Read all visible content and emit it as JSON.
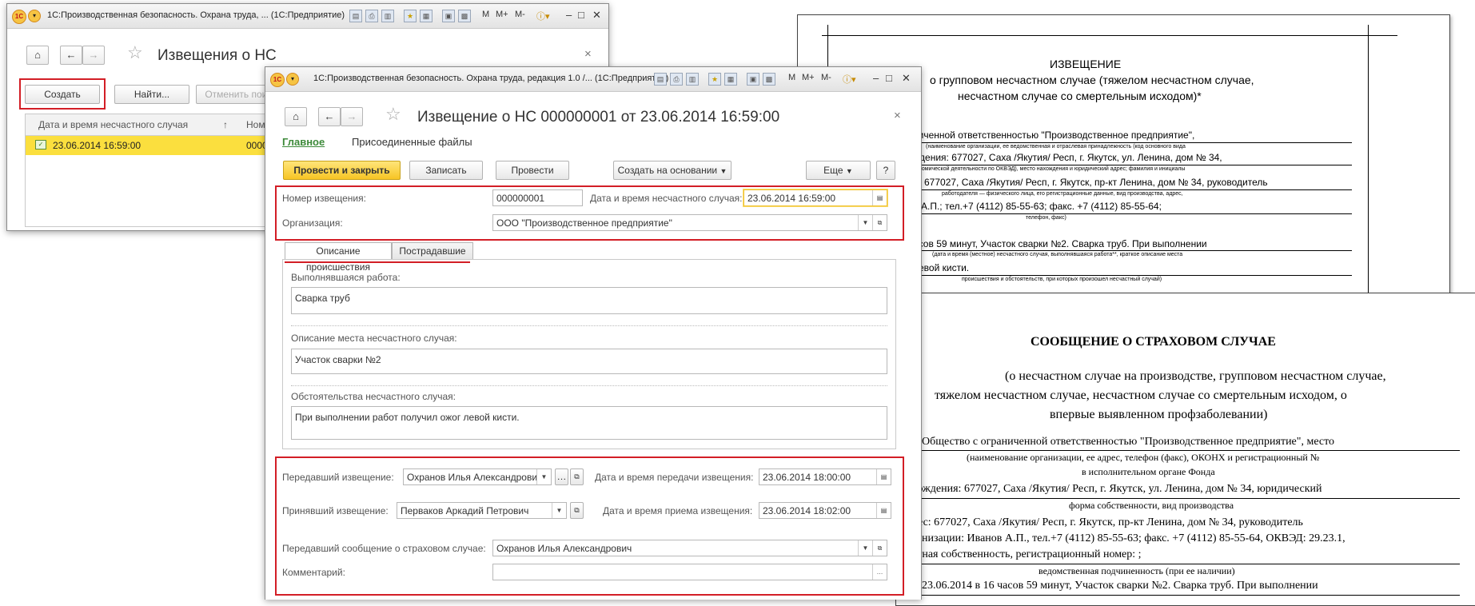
{
  "window_back": {
    "title": "1С:Производственная безопасность. Охрана труда, ...  (1С:Предприятие)",
    "heading": "Извещения о НС",
    "buttons": {
      "create": "Создать",
      "find": "Найти...",
      "cancel_find": "Отменить поиск"
    },
    "list": {
      "col1": "Дата и время несчастного случая",
      "col1_sort": "↑",
      "col2": "Номер",
      "row_date": "23.06.2014 16:59:00",
      "row_num": "000000001"
    }
  },
  "window_front": {
    "title": "1С:Производственная безопасность. Охрана труда, редакция 1.0 /...  (1С:Предприятие)",
    "heading": "Извещение о НС 000000001 от 23.06.2014 16:59:00",
    "nav": {
      "main": "Главное",
      "files": "Присоединенные файлы"
    },
    "toolbar": {
      "post_close": "Провести и закрыть",
      "save": "Записать",
      "post": "Провести",
      "create_based": "Создать на основании",
      "more": "Еще",
      "help": "?"
    },
    "fields": {
      "number_label": "Номер извещения:",
      "number_value": "000000001",
      "datetime_label": "Дата и время несчастного случая:",
      "datetime_value": "23.06.2014 16:59:00",
      "org_label": "Организация:",
      "org_value": "ООО \"Производственное предприятие\""
    },
    "tabs": {
      "description": "Описание происшествия",
      "victims": "Пострадавшие"
    },
    "description": {
      "work_label": "Выполнявшаяся работа:",
      "work_value": "Сварка труб",
      "place_label": "Описание места несчастного случая:",
      "place_value": "Участок сварки №2",
      "circ_label": "Обстоятельства несчастного случая:",
      "circ_value": "При выполнении работ получил ожог левой кисти."
    },
    "transfer": {
      "sender_label": "Передавший извещение:",
      "sender_value": "Охранов Илья Александрови",
      "send_dt_label": "Дата и время передачи извещения:",
      "send_dt_value": "23.06.2014 18:00:00",
      "receiver_label": "Принявший извещение:",
      "receiver_value": "Перваков Аркадий Петрович",
      "recv_dt_label": "Дата и время приема извещения:",
      "recv_dt_value": "23.06.2014 18:02:00",
      "insurance_label": "Передавший сообщение о страховом случае:",
      "insurance_value": "Охранов Илья Александрович",
      "comment_label": "Комментарий:",
      "comment_value": ""
    }
  },
  "doc1": {
    "title": "ИЗВЕЩЕНИЕ",
    "line1": "о групповом несчастном случае (тяжелом несчастном случае,",
    "line2": "несчастном случае со смертельным исходом)*",
    "line3": "ниченной ответственностью \"Производственное предприятие\",",
    "note3": "(наименование организации, ее ведомственная и отраслевая принадлежность (код основного вида",
    "line4": "ждения: 677027, Саха /Якутия/ Респ, г. Якутск, ул. Ленина, дом № 34,",
    "note4": "кономической деятельности по ОКВЭД), место нахождения и юридический адрес; фамилия и инициалы",
    "line5": "677027, Саха /Якутия/ Респ, г. Якутск, пр-кт Ленина, дом № 34, руководитель",
    "note5": "работодателя — физического лица, его регистрационные данные, вид производства, адрес,",
    "line6": "е А.П.; тел.+7 (4112) 85-55-63; факс. +7 (4112) 85-55-64;",
    "note6": "телефон, факс)",
    "line7": "асов 59 минут, Участок сварки №2. Сварка труб. При выполнении",
    "note7": "(дата и время (местное) несчастного случая, выполнявшаяся работа**, краткое описание места",
    "line8": "левой кисти.",
    "note8": "происшествия и обстоятельств, при которых произошел несчастный случай)"
  },
  "doc2": {
    "title": "СООБЩЕНИЕ О СТРАХОВОМ СЛУЧАЕ",
    "sub1": "(о несчастном случае на производстве, групповом несчастном случае,",
    "sub2": "тяжелом несчастном случае, несчастном случае со смертельным исходом, о",
    "sub3": "впервые выявленном профзаболевании)",
    "line1": "Общество с ограниченной ответственностью \"Производственное предприятие\", место",
    "note1": "(наименование организации, ее адрес, телефон (факс), ОКОНХ и регистрационный №",
    "note1b": "в исполнительном органе Фонда",
    "line2": "хождения: 677027, Саха /Якутия/ Респ, г. Якутск, ул. Ленина, дом № 34, юридический",
    "note2": "форма собственности, вид производства",
    "line3": "рес: 677027, Саха /Якутия/ Респ, г. Якутск, пр-кт Ленина, дом № 34, руководитель",
    "line4": "ганизации: Иванов А.П., тел.+7 (4112) 85-55-63; факс. +7 (4112) 85-55-64, ОКВЭД: 29.23.1,",
    "line5": "стная собственность, регистрационный номер: ;",
    "note5": "ведомственная подчиненность (при ее наличии)",
    "line6": "23.06.2014 в 16 часов 59 минут, Участок сварки №2. Сварка труб. При выполнении"
  }
}
